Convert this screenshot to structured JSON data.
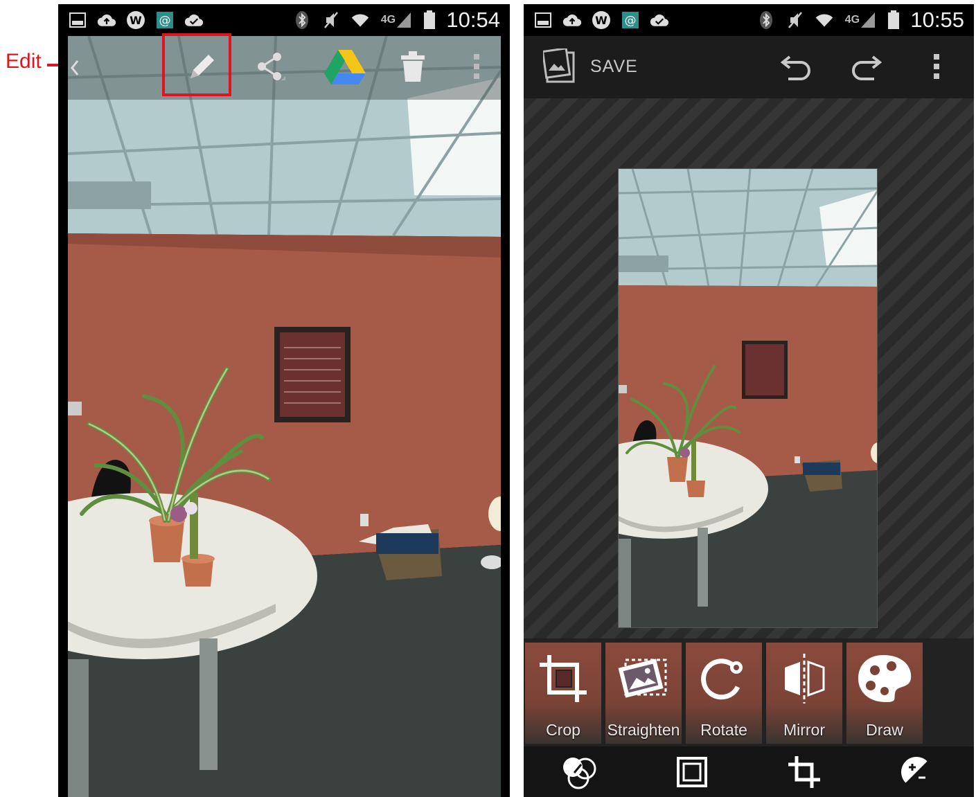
{
  "annotation": {
    "label": "Edit",
    "color": "#e0141e"
  },
  "left_screen": {
    "status_bar": {
      "time": "10:54",
      "network": "4G",
      "left_icons": [
        "gallery-icon",
        "cloud-upload-icon",
        "w-app-icon",
        "email-icon",
        "check-icon"
      ],
      "right_icons": [
        "bluetooth-icon",
        "mute-icon",
        "wifi-icon",
        "signal-icon",
        "battery-icon"
      ]
    },
    "toolbar": {
      "actions": [
        "edit-icon",
        "share-icon",
        "google-drive-icon",
        "trash-icon",
        "overflow-menu-icon"
      ]
    }
  },
  "right_screen": {
    "status_bar": {
      "time": "10:55",
      "network": "4G"
    },
    "action_bar": {
      "save_label": "SAVE",
      "actions": [
        "undo-icon",
        "redo-icon",
        "overflow-menu-icon"
      ]
    },
    "tools": [
      {
        "label": "Crop",
        "icon": "crop-icon"
      },
      {
        "label": "Straighten",
        "icon": "straighten-icon"
      },
      {
        "label": "Rotate",
        "icon": "rotate-icon"
      },
      {
        "label": "Mirror",
        "icon": "mirror-icon"
      },
      {
        "label": "Draw",
        "icon": "draw-palette-icon"
      }
    ],
    "bottom_nav": {
      "items": [
        "filters-icon",
        "frames-icon",
        "geometry-icon",
        "exposure-icon"
      ],
      "selected": "geometry-icon"
    }
  },
  "colors": {
    "wall": "#a65a48",
    "ceiling": "#b8cfcf",
    "carpet": "#3a403d",
    "table": "#e8e8e0",
    "editor_bg": "#1c1c1c"
  }
}
